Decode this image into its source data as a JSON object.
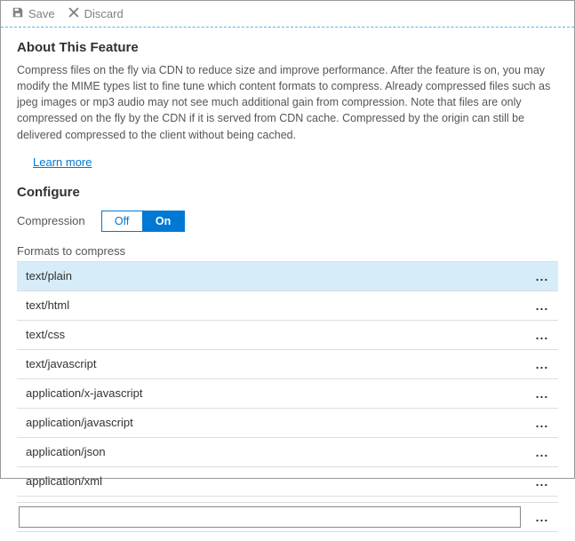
{
  "toolbar": {
    "save_label": "Save",
    "discard_label": "Discard"
  },
  "about": {
    "title": "About This Feature",
    "description": "Compress files on the fly via CDN to reduce size and improve performance. After the feature is on, you may modify the MIME types list to fine tune which content formats to compress. Already compressed files such as jpeg images or mp3 audio may not see much additional gain from compression. Note that files are only compressed on the fly by the CDN if it is served from CDN cache. Compressed by the origin can still be delivered compressed to the client without being cached.",
    "learn_more": "Learn more"
  },
  "configure": {
    "title": "Configure",
    "compression_label": "Compression",
    "off_label": "Off",
    "on_label": "On",
    "formats_label": "Formats to compress",
    "formats": [
      "text/plain",
      "text/html",
      "text/css",
      "text/javascript",
      "application/x-javascript",
      "application/javascript",
      "application/json",
      "application/xml"
    ],
    "dots": "...",
    "new_format_value": ""
  }
}
